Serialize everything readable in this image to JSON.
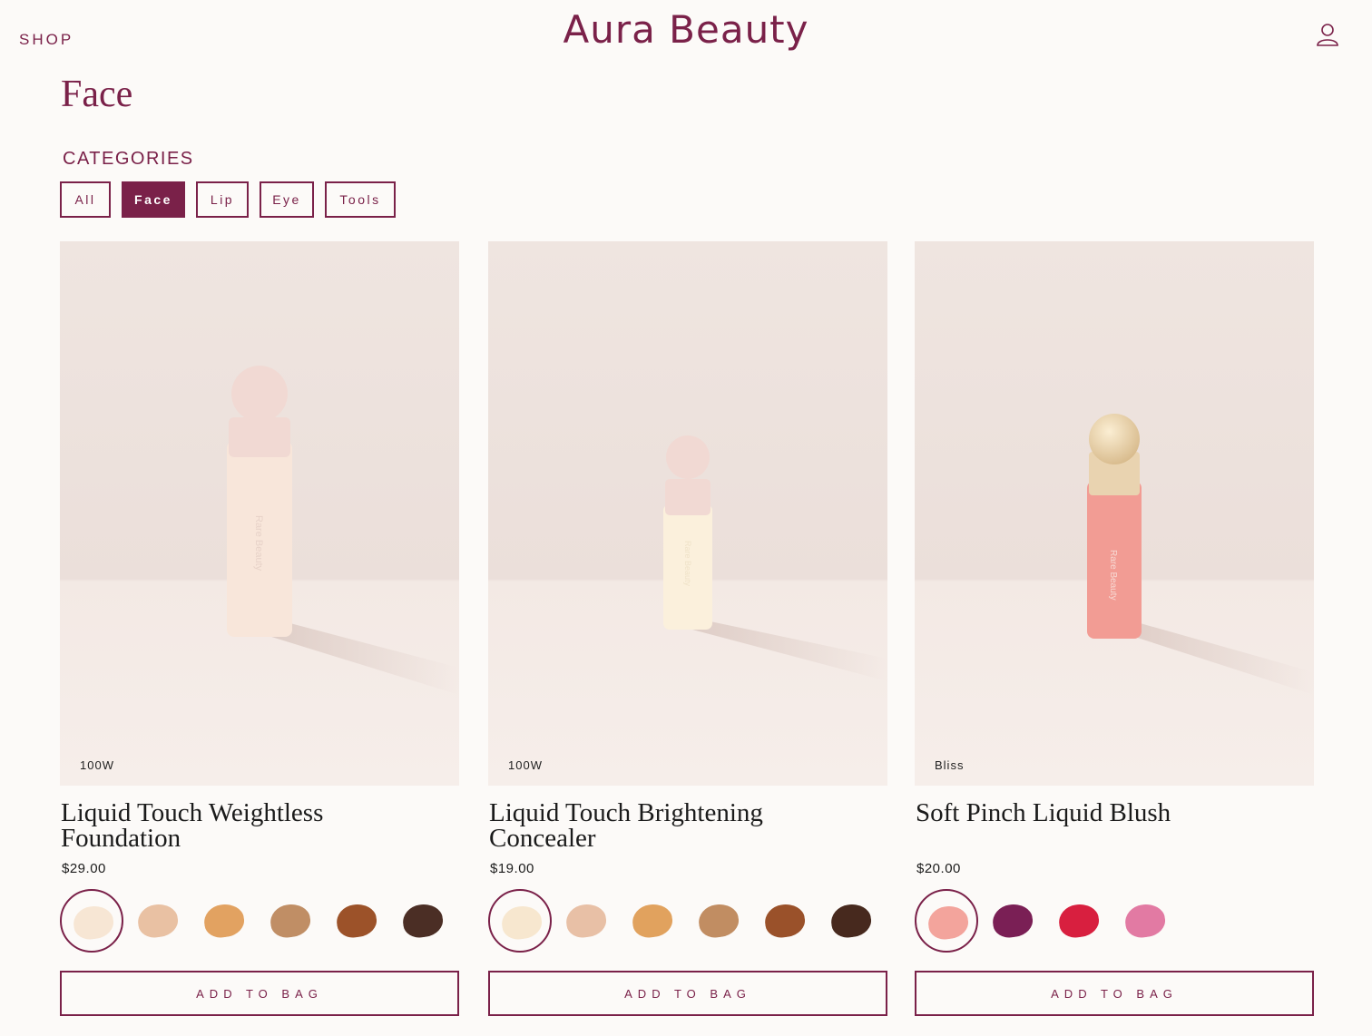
{
  "header": {
    "shop_label": "SHOP",
    "brand": "Aura Beauty",
    "account_icon": "user-icon"
  },
  "page": {
    "title": "Face"
  },
  "categories": {
    "heading": "CATEGORIES",
    "items": [
      "All",
      "Face",
      "Lip",
      "Eye",
      "Tools"
    ],
    "selected": "Face"
  },
  "colors": {
    "accent": "#7a2149",
    "background": "#fcfaf8"
  },
  "products": [
    {
      "name": "Liquid Touch Weightless Foundation",
      "price": "$29.00",
      "shade": "100W",
      "bottle_text": "Rare Beauty",
      "bottle_color": "#f8e6da",
      "cap_color": "#f1d9d3",
      "swatches": [
        "#f7e6d4",
        "#e9c1a3",
        "#e2a261",
        "#c08e65",
        "#9c5229",
        "#4b2e25"
      ],
      "selected_swatch": 0,
      "add_label": "ADD TO BAG"
    },
    {
      "name": "Liquid Touch Brightening Concealer",
      "price": "$19.00",
      "shade": "100W",
      "bottle_text": "Rare Beauty",
      "bottle_color": "#fbf0dc",
      "cap_color": "#f1d9d3",
      "swatches": [
        "#f7e7cf",
        "#e8c0a6",
        "#e1a25e",
        "#c18d62",
        "#9a512a",
        "#47291e"
      ],
      "selected_swatch": 0,
      "add_label": "ADD TO BAG"
    },
    {
      "name": "Soft Pinch Liquid Blush",
      "price": "$20.00",
      "shade": "Bliss",
      "bottle_text": "Rare Beauty",
      "bottle_color": "#f29c94",
      "cap_color": "#e9d3b0",
      "swatches": [
        "#f3a49c",
        "#7a1f55",
        "#d81f3f",
        "#e27aa3"
      ],
      "selected_swatch": 0,
      "add_label": "ADD TO BAG"
    }
  ]
}
